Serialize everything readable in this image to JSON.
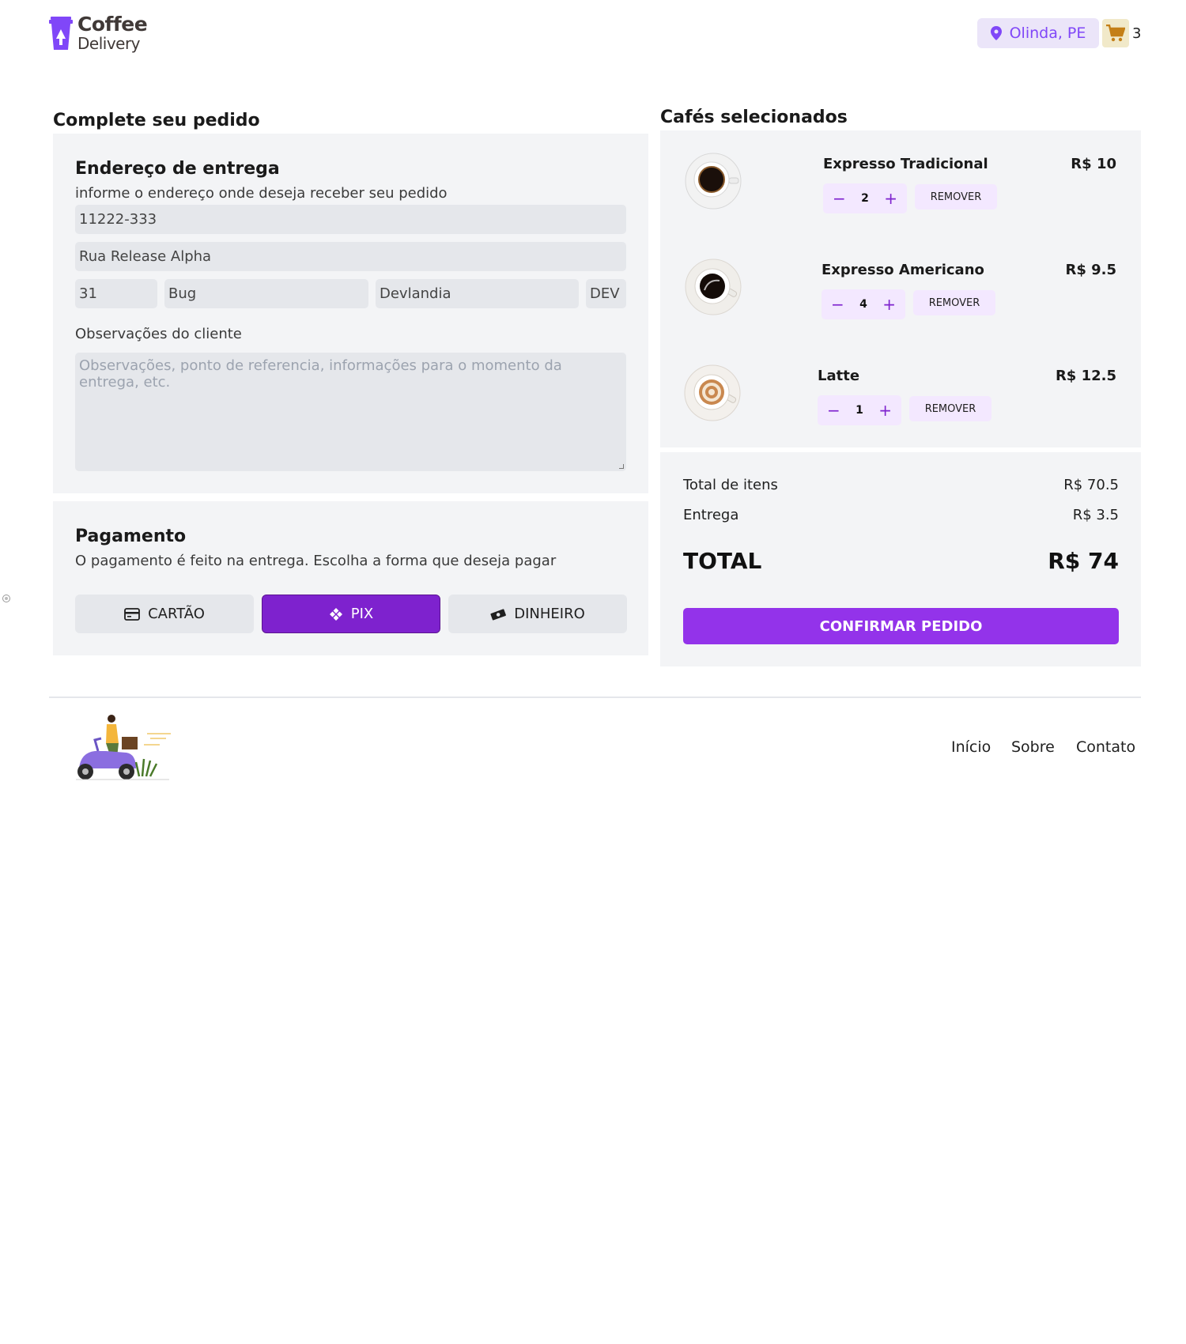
{
  "header": {
    "logo_line1": "Coffee",
    "logo_line2": "Delivery",
    "location": "Olinda, PE",
    "cart_count": "3"
  },
  "order": {
    "title": "Complete seu pedido",
    "address": {
      "heading": "Endereço de entrega",
      "subtitle": "informe o endereço onde deseja receber seu pedido",
      "cep": "11222-333",
      "street": "Rua Release Alpha",
      "number": "31",
      "complement": "Bug",
      "city": "Devlandia",
      "uf": "DEV",
      "notes_label": "Observações do cliente",
      "notes_placeholder": "Observações, ponto de referencia, informações para o momento da entrega, etc."
    },
    "payment": {
      "heading": "Pagamento",
      "subtitle": "O pagamento é feito na entrega. Escolha a forma que deseja pagar",
      "options": [
        "CARTÃO",
        "PIX",
        "DINHEIRO"
      ],
      "selected": "PIX"
    }
  },
  "cart": {
    "title": "Cafés selecionados",
    "items": [
      {
        "name": "Expresso Tradicional",
        "price": "R$ 10",
        "qty": "2",
        "remove": "REMOVER"
      },
      {
        "name": "Expresso Americano",
        "price": "R$ 9.5",
        "qty": "4",
        "remove": "REMOVER"
      },
      {
        "name": "Latte",
        "price": "R$ 12.5",
        "qty": "1",
        "remove": "REMOVER"
      }
    ],
    "summary": {
      "items_label": "Total de itens",
      "items_value": "R$ 70.5",
      "delivery_label": "Entrega",
      "delivery_value": "R$ 3.5",
      "total_label": "TOTAL",
      "total_value": "R$ 74"
    },
    "confirm_label": "CONFIRMAR PEDIDO"
  },
  "footer": {
    "links": [
      "Início",
      "Sobre",
      "Contato"
    ]
  },
  "colors": {
    "brand_purple": "#8047f8",
    "pix_selected": "#7e22ce",
    "confirm_button": "#9333ea",
    "panel_bg": "#f3f4f6",
    "field_bg": "#e5e7eb",
    "cart_yellow": "#f1e9c9"
  }
}
